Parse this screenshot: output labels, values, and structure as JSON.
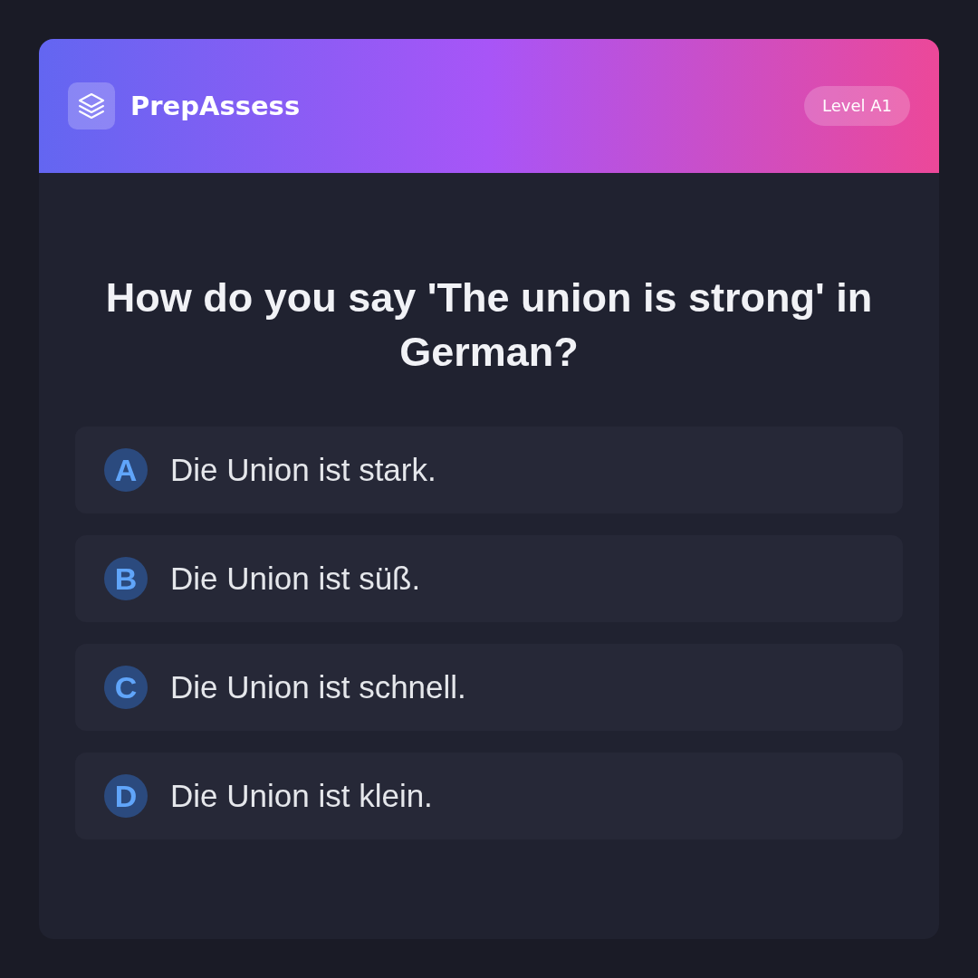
{
  "header": {
    "brand": "PrepAssess",
    "level_badge": "Level A1"
  },
  "question": "How do you say 'The union is strong' in German?",
  "options": [
    {
      "letter": "A",
      "text": "Die Union ist stark.",
      "selected": false
    },
    {
      "letter": "B",
      "text": "Die Union ist süß.",
      "selected": false
    },
    {
      "letter": "C",
      "text": "Die Union ist schnell.",
      "selected": false
    },
    {
      "letter": "D",
      "text": "Die Union ist klein.",
      "selected": false
    }
  ]
}
